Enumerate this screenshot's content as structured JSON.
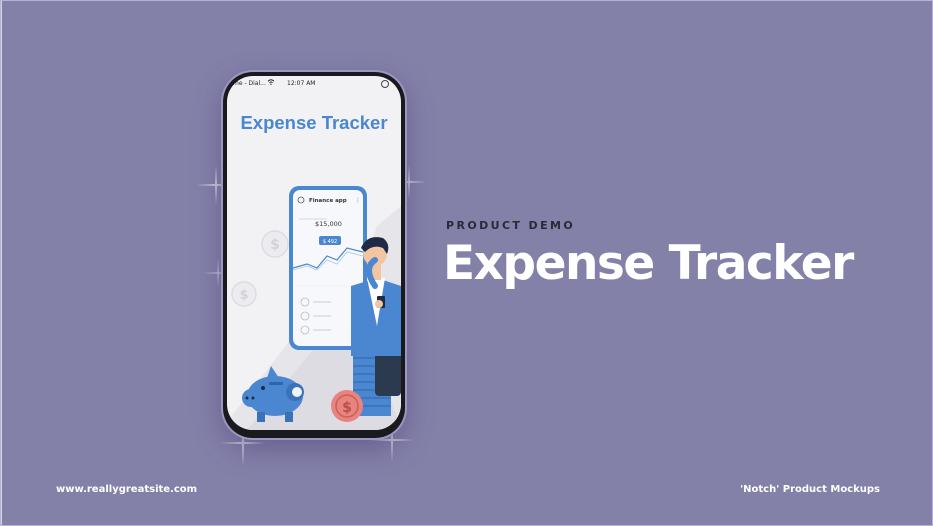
{
  "phone": {
    "status_carrier": "me - Dial...",
    "status_time": "12:07 AM",
    "app_title": "Expense Tracker",
    "mini_app": {
      "title": "Finance app",
      "balance": "$15,000",
      "badge": "$ 492"
    }
  },
  "hero": {
    "eyebrow": "PRODUCT DEMO",
    "headline": "Expense Tracker"
  },
  "footer": {
    "website": "www.reallygreatsite.com",
    "caption": "'Notch' Product Mockups"
  },
  "colors": {
    "background": "#8481a9",
    "accent_blue": "#4a87d0",
    "eyebrow_text": "#2b2838"
  }
}
